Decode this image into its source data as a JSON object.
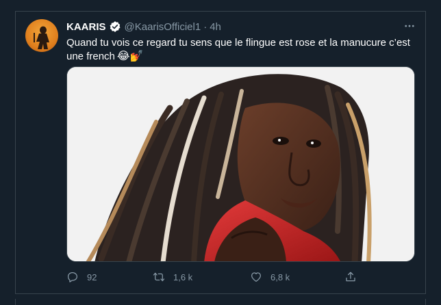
{
  "tweet": {
    "author_name": "KAARIS",
    "handle": "@KaarisOfficiel1",
    "separator": "·",
    "time": "4h",
    "text": "Quand tu vois ce regard tu sens que le flingue est rose et la manucure c’est une french",
    "emojis": "😂💅",
    "reply_count": "92",
    "retweet_count": "1,6 k",
    "like_count": "6,8 k"
  },
  "icons": {
    "verified": "verified-badge-icon",
    "more": "more-options-icon",
    "reply": "reply-icon",
    "retweet": "retweet-icon",
    "like": "like-icon",
    "share": "share-icon"
  },
  "colors": {
    "background": "#15202b",
    "border": "#38444d",
    "muted": "#8899a6",
    "text": "#ffffff"
  }
}
